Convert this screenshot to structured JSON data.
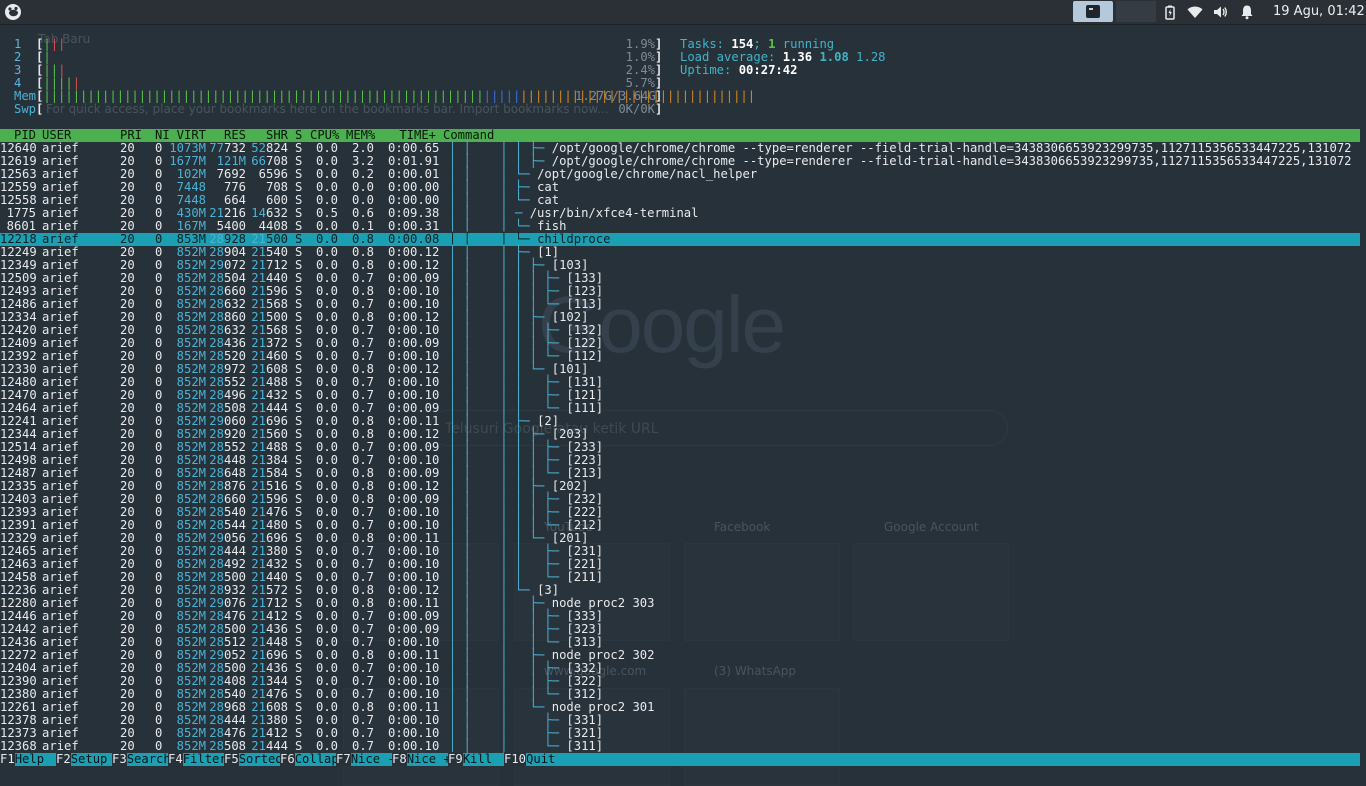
{
  "panel": {
    "clock": "19 Agu, 01:42",
    "icons": [
      "xfce-menu-icon",
      "terminal-task-icon",
      "battery-icon",
      "wifi-icon",
      "volume-icon",
      "notification-icon"
    ]
  },
  "ghost": {
    "google": "Google",
    "search_placeholder": "Telusuri Google atau ketik URL",
    "tab_title": "Tab Baru",
    "bookmarks_hint": "For quick access, place your bookmarks here on the bookmarks bar. Import bookmarks now...",
    "tiles": [
      "YouTube",
      "Facebook",
      "Google Account",
      "www.google.com",
      "(3) WhatsApp"
    ]
  },
  "htop": {
    "cpus": [
      {
        "n": "1",
        "pct": "1.9%"
      },
      {
        "n": "2",
        "pct": "1.0%"
      },
      {
        "n": "3",
        "pct": "2.4%"
      },
      {
        "n": "4",
        "pct": "5.7%"
      }
    ],
    "mem_label": "Mem",
    "mem_value": "1.27G/3.64G",
    "swp_label": "Swp",
    "swp_value": "0K/0K",
    "tasks_label": "Tasks:",
    "tasks": "154",
    "threads": "1",
    "running": "running",
    "load_label": "Load average:",
    "load1": "1.36",
    "load5": "1.08",
    "load15": "1.28",
    "uptime_label": "Uptime:",
    "uptime": "00:27:42",
    "columns": [
      "PID",
      "USER",
      "PRI",
      "NI",
      "VIRT",
      "RES",
      "SHR",
      "S",
      "CPU%",
      "MEM%",
      "TIME+",
      "Command"
    ],
    "selected_index": 7,
    "rows": [
      [
        "12640",
        "arief",
        "20",
        "0",
        "1073M",
        "77732",
        "52824",
        "S",
        "0.0",
        "2.0",
        "0:00.65",
        "│ ├─ /opt/google/chrome/chrome --type=renderer --field-trial-handle=3438306653923299735,112711535653344722​5,131072"
      ],
      [
        "12619",
        "arief",
        "20",
        "0",
        "1677M",
        "121M",
        "66708",
        "S",
        "0.0",
        "3.2",
        "0:01.91",
        "│ ├─ /opt/google/chrome/chrome --type=renderer --field-trial-handle=3438306653923299735,112711535653344722​5,131072"
      ],
      [
        "12563",
        "arief",
        "20",
        "0",
        "102M",
        "7692",
        "6596",
        "S",
        "0.0",
        "0.2",
        "0:00.01",
        "└─ /opt/google/chrome/nacl_helper"
      ],
      [
        "12559",
        "arief",
        "20",
        "0",
        "7448",
        "776",
        "708",
        "S",
        "0.0",
        "0.0",
        "0:00.00",
        "├─ cat"
      ],
      [
        "12558",
        "arief",
        "20",
        "0",
        "7448",
        "664",
        "600",
        "S",
        "0.0",
        "0.0",
        "0:00.00",
        "└─ cat"
      ],
      [
        "1775",
        "arief",
        "20",
        "0",
        "430M",
        "21216",
        "14632",
        "S",
        "0.5",
        "0.6",
        "0:09.38",
        "─ /usr/bin/xfce4-terminal"
      ],
      [
        "8601",
        "arief",
        "20",
        "0",
        "167M",
        "5400",
        "4408",
        "S",
        "0.0",
        "0.1",
        "0:00.31",
        "└─ fish"
      ],
      [
        "12218",
        "arief",
        "20",
        "0",
        "853M",
        "28928",
        "21500",
        "S",
        "0.0",
        "0.8",
        "0:00.08",
        "└─ childproce"
      ],
      [
        "12249",
        "arief",
        "20",
        "0",
        "852M",
        "28904",
        "21540",
        "S",
        "0.0",
        "0.8",
        "0:00.12",
        "├─ [1]"
      ],
      [
        "12349",
        "arief",
        "20",
        "0",
        "852M",
        "29072",
        "21712",
        "S",
        "0.0",
        "0.8",
        "0:00.12",
        "│ ├─ [103]"
      ],
      [
        "12509",
        "arief",
        "20",
        "0",
        "852M",
        "28504",
        "21440",
        "S",
        "0.0",
        "0.7",
        "0:00.09",
        "│ │ ├─ [133]"
      ],
      [
        "12493",
        "arief",
        "20",
        "0",
        "852M",
        "28660",
        "21596",
        "S",
        "0.0",
        "0.8",
        "0:00.10",
        "│ │ ├─ [123]"
      ],
      [
        "12486",
        "arief",
        "20",
        "0",
        "852M",
        "28632",
        "21568",
        "S",
        "0.0",
        "0.7",
        "0:00.10",
        "│ │ └─ [113]"
      ],
      [
        "12334",
        "arief",
        "20",
        "0",
        "852M",
        "28860",
        "21500",
        "S",
        "0.0",
        "0.8",
        "0:00.12",
        "│ ├─ [102]"
      ],
      [
        "12420",
        "arief",
        "20",
        "0",
        "852M",
        "28632",
        "21568",
        "S",
        "0.0",
        "0.7",
        "0:00.10",
        "│ │ ├─ [132]"
      ],
      [
        "12409",
        "arief",
        "20",
        "0",
        "852M",
        "28436",
        "21372",
        "S",
        "0.0",
        "0.7",
        "0:00.09",
        "│ │ ├─ [122]"
      ],
      [
        "12392",
        "arief",
        "20",
        "0",
        "852M",
        "28520",
        "21460",
        "S",
        "0.0",
        "0.7",
        "0:00.10",
        "│ │ └─ [112]"
      ],
      [
        "12330",
        "arief",
        "20",
        "0",
        "852M",
        "28972",
        "21608",
        "S",
        "0.0",
        "0.8",
        "0:00.12",
        "│ └─ [101]"
      ],
      [
        "12480",
        "arief",
        "20",
        "0",
        "852M",
        "28552",
        "21488",
        "S",
        "0.0",
        "0.7",
        "0:00.10",
        "│   ├─ [131]"
      ],
      [
        "12470",
        "arief",
        "20",
        "0",
        "852M",
        "28496",
        "21432",
        "S",
        "0.0",
        "0.7",
        "0:00.10",
        "│   ├─ [121]"
      ],
      [
        "12464",
        "arief",
        "20",
        "0",
        "852M",
        "28508",
        "21444",
        "S",
        "0.0",
        "0.7",
        "0:00.09",
        "│   └─ [111]"
      ],
      [
        "12241",
        "arief",
        "20",
        "0",
        "852M",
        "29060",
        "21696",
        "S",
        "0.0",
        "0.8",
        "0:00.11",
        "├─ [2]"
      ],
      [
        "12344",
        "arief",
        "20",
        "0",
        "852M",
        "28920",
        "21560",
        "S",
        "0.0",
        "0.8",
        "0:00.12",
        "│ ├─ [203]"
      ],
      [
        "12514",
        "arief",
        "20",
        "0",
        "852M",
        "28552",
        "21488",
        "S",
        "0.0",
        "0.7",
        "0:00.09",
        "│ │ ├─ [233]"
      ],
      [
        "12498",
        "arief",
        "20",
        "0",
        "852M",
        "28448",
        "21384",
        "S",
        "0.0",
        "0.7",
        "0:00.10",
        "│ │ ├─ [223]"
      ],
      [
        "12487",
        "arief",
        "20",
        "0",
        "852M",
        "28648",
        "21584",
        "S",
        "0.0",
        "0.8",
        "0:00.09",
        "│ │ └─ [213]"
      ],
      [
        "12335",
        "arief",
        "20",
        "0",
        "852M",
        "28876",
        "21516",
        "S",
        "0.0",
        "0.8",
        "0:00.12",
        "│ ├─ [202]"
      ],
      [
        "12403",
        "arief",
        "20",
        "0",
        "852M",
        "28660",
        "21596",
        "S",
        "0.0",
        "0.8",
        "0:00.09",
        "│ │ ├─ [232]"
      ],
      [
        "12393",
        "arief",
        "20",
        "0",
        "852M",
        "28540",
        "21476",
        "S",
        "0.0",
        "0.7",
        "0:00.10",
        "│ │ ├─ [222]"
      ],
      [
        "12391",
        "arief",
        "20",
        "0",
        "852M",
        "28544",
        "21480",
        "S",
        "0.0",
        "0.7",
        "0:00.10",
        "│ │ └─ [212]"
      ],
      [
        "12329",
        "arief",
        "20",
        "0",
        "852M",
        "29056",
        "21696",
        "S",
        "0.0",
        "0.8",
        "0:00.11",
        "│ └─ [201]"
      ],
      [
        "12465",
        "arief",
        "20",
        "0",
        "852M",
        "28444",
        "21380",
        "S",
        "0.0",
        "0.7",
        "0:00.10",
        "│   ├─ [231]"
      ],
      [
        "12463",
        "arief",
        "20",
        "0",
        "852M",
        "28492",
        "21432",
        "S",
        "0.0",
        "0.7",
        "0:00.10",
        "│   ├─ [221]"
      ],
      [
        "12458",
        "arief",
        "20",
        "0",
        "852M",
        "28500",
        "21440",
        "S",
        "0.0",
        "0.7",
        "0:00.10",
        "│   └─ [211]"
      ],
      [
        "12236",
        "arief",
        "20",
        "0",
        "852M",
        "28932",
        "21572",
        "S",
        "0.0",
        "0.8",
        "0:00.12",
        "└─ [3]"
      ],
      [
        "12280",
        "arief",
        "20",
        "0",
        "852M",
        "29076",
        "21712",
        "S",
        "0.0",
        "0.8",
        "0:00.11",
        "  ├─ node proc2 303"
      ],
      [
        "12446",
        "arief",
        "20",
        "0",
        "852M",
        "28476",
        "21412",
        "S",
        "0.0",
        "0.7",
        "0:00.09",
        "  │ ├─ [333]"
      ],
      [
        "12442",
        "arief",
        "20",
        "0",
        "852M",
        "28500",
        "21436",
        "S",
        "0.0",
        "0.7",
        "0:00.09",
        "  │ ├─ [323]"
      ],
      [
        "12436",
        "arief",
        "20",
        "0",
        "852M",
        "28512",
        "21448",
        "S",
        "0.0",
        "0.7",
        "0:00.10",
        "  │ └─ [313]"
      ],
      [
        "12272",
        "arief",
        "20",
        "0",
        "852M",
        "29052",
        "21696",
        "S",
        "0.0",
        "0.8",
        "0:00.11",
        "  ├─ node proc2 302"
      ],
      [
        "12404",
        "arief",
        "20",
        "0",
        "852M",
        "28500",
        "21436",
        "S",
        "0.0",
        "0.7",
        "0:00.10",
        "  │ ├─ [332]"
      ],
      [
        "12390",
        "arief",
        "20",
        "0",
        "852M",
        "28408",
        "21344",
        "S",
        "0.0",
        "0.7",
        "0:00.10",
        "  │ ├─ [322]"
      ],
      [
        "12380",
        "arief",
        "20",
        "0",
        "852M",
        "28540",
        "21476",
        "S",
        "0.0",
        "0.7",
        "0:00.10",
        "  │ └─ [312]"
      ],
      [
        "12261",
        "arief",
        "20",
        "0",
        "852M",
        "28968",
        "21608",
        "S",
        "0.0",
        "0.8",
        "0:00.11",
        "  └─ node proc2 301"
      ],
      [
        "12378",
        "arief",
        "20",
        "0",
        "852M",
        "28444",
        "21380",
        "S",
        "0.0",
        "0.7",
        "0:00.10",
        "    ├─ [331]"
      ],
      [
        "12373",
        "arief",
        "20",
        "0",
        "852M",
        "28476",
        "21412",
        "S",
        "0.0",
        "0.7",
        "0:00.10",
        "    ├─ [321]"
      ],
      [
        "12368",
        "arief",
        "20",
        "0",
        "852M",
        "28508",
        "21444",
        "S",
        "0.0",
        "0.7",
        "0:00.10",
        "    └─ [311]"
      ]
    ],
    "fkeys": [
      {
        "key": "F1",
        "label": "Help"
      },
      {
        "key": "F2",
        "label": "Setup"
      },
      {
        "key": "F3",
        "label": "Search"
      },
      {
        "key": "F4",
        "label": "Filter"
      },
      {
        "key": "F5",
        "label": "Sorted"
      },
      {
        "key": "F6",
        "label": "Collap"
      },
      {
        "key": "F7",
        "label": "Nice -"
      },
      {
        "key": "F8",
        "label": "Nice +"
      },
      {
        "key": "F9",
        "label": "Kill"
      },
      {
        "key": "F10",
        "label": "Quit"
      }
    ]
  },
  "colors": {
    "header_bar": "#4caf50",
    "selection": "#1aa0b2",
    "terminal_bg": "#273139",
    "accent_cyan": "#4bb3d6"
  }
}
